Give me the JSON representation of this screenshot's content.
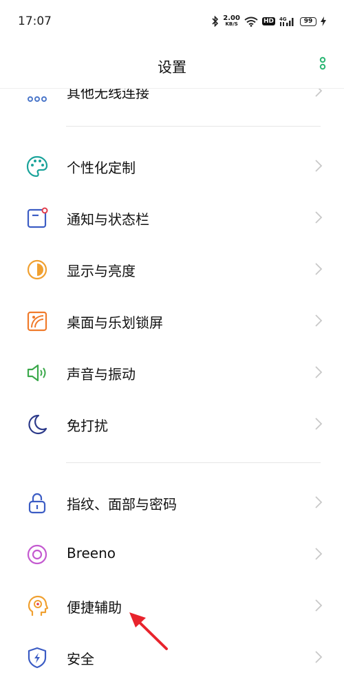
{
  "status": {
    "time": "17:07",
    "speed_value": "2.00",
    "speed_unit": "KB/S",
    "hd": "HD",
    "network": "4G",
    "battery": "99"
  },
  "header": {
    "title": "设置"
  },
  "items": [
    {
      "label": "其他无线连接",
      "icon": "wireless-icon"
    },
    {
      "label": "个性化定制",
      "icon": "palette-icon"
    },
    {
      "label": "通知与状态栏",
      "icon": "notification-icon"
    },
    {
      "label": "显示与亮度",
      "icon": "brightness-icon"
    },
    {
      "label": "桌面与乐划锁屏",
      "icon": "wallpaper-icon"
    },
    {
      "label": "声音与振动",
      "icon": "speaker-icon"
    },
    {
      "label": "免打扰",
      "icon": "moon-icon"
    },
    {
      "label": "指纹、面部与密码",
      "icon": "lock-icon"
    },
    {
      "label": "Breeno",
      "icon": "breeno-icon"
    },
    {
      "label": "便捷辅助",
      "icon": "assist-icon"
    },
    {
      "label": "安全",
      "icon": "shield-icon"
    }
  ],
  "colors": {
    "accent": "#2bb673",
    "arrow": "#e8232c"
  }
}
